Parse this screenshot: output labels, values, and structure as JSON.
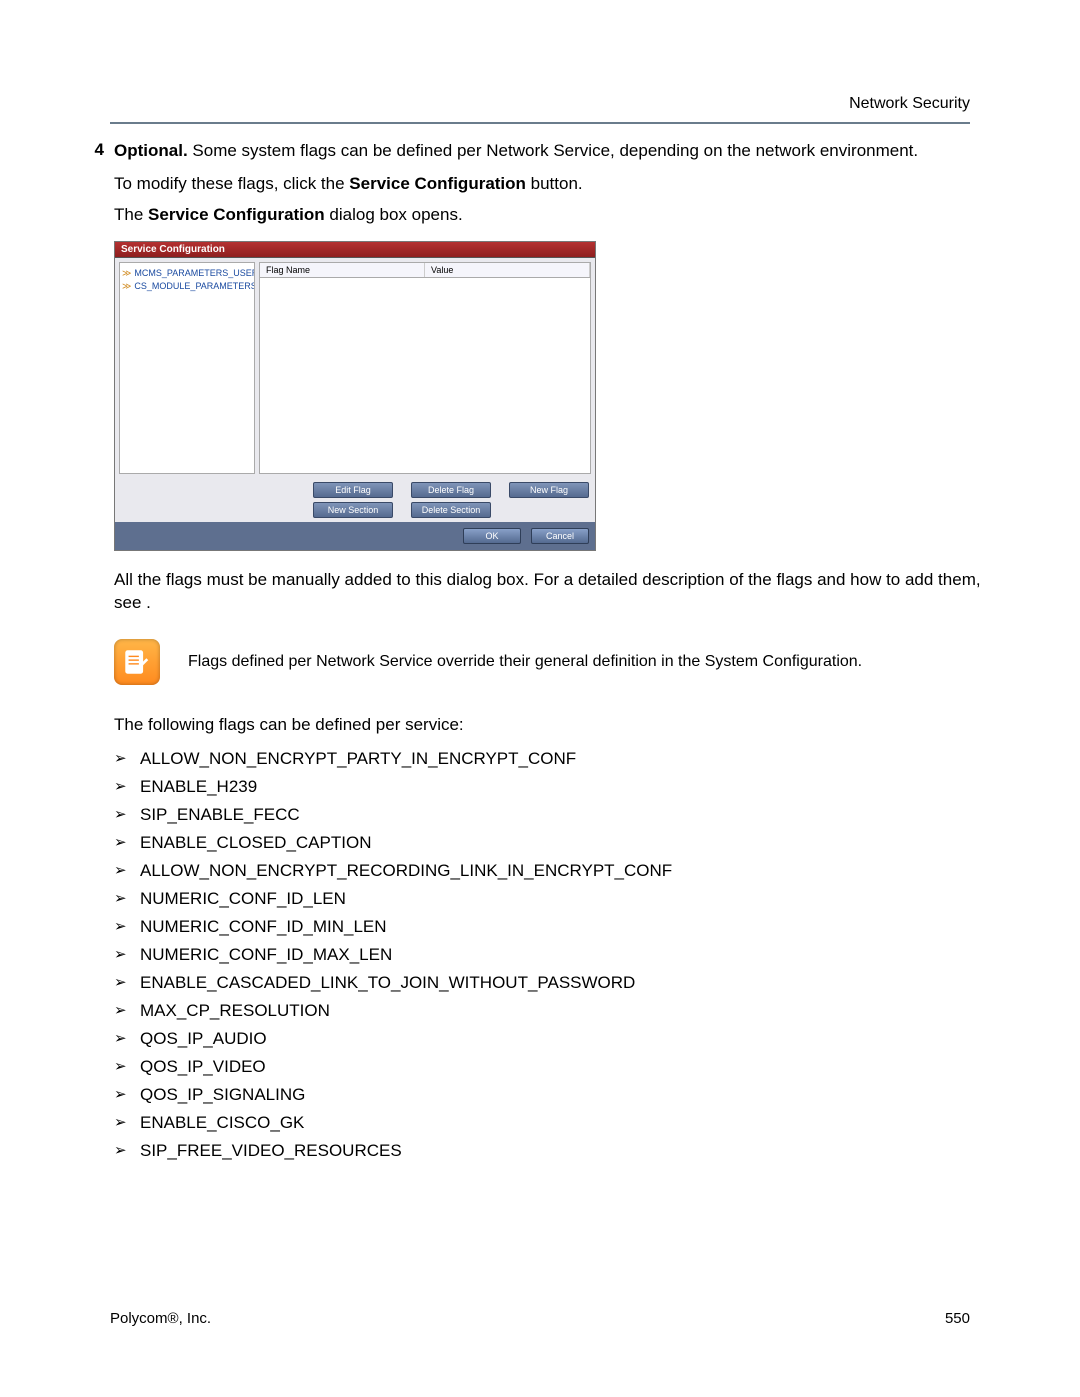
{
  "header": {
    "title": "Network Security"
  },
  "step": {
    "num": "4",
    "lead_bold": "Optional.",
    "lead_rest": " Some system flags can be defined per Network Service, depending on the network environment.",
    "modify_pre": "To modify these flags, click the ",
    "modify_bold": "Service Configuration",
    "modify_post": " button.",
    "open_pre": "The ",
    "open_bold": "Service Configuration",
    "open_post": " dialog box opens."
  },
  "dialog": {
    "title": "Service Configuration",
    "tree": [
      "MCMS_PARAMETERS_USER",
      "CS_MODULE_PARAMETERS"
    ],
    "columns": {
      "c1": "Flag Name",
      "c2": "Value"
    },
    "buttons": {
      "edit_flag": "Edit Flag",
      "delete_flag": "Delete Flag",
      "new_flag": "New Flag",
      "new_section": "New Section",
      "delete_section": "Delete Section",
      "ok": "OK",
      "cancel": "Cancel"
    }
  },
  "after_dialog": "All the flags must be manually added to this dialog box. For a detailed description of the flags and how to add them, see .",
  "note": "Flags defined per Network Service override their general definition in the System Configuration.",
  "flags_intro": "The following flags can be defined per service:",
  "flags": [
    "ALLOW_NON_ENCRYPT_PARTY_IN_ENCRYPT_CONF",
    "ENABLE_H239",
    "SIP_ENABLE_FECC",
    "ENABLE_CLOSED_CAPTION",
    "ALLOW_NON_ENCRYPT_RECORDING_LINK_IN_ENCRYPT_CONF",
    "NUMERIC_CONF_ID_LEN",
    "NUMERIC_CONF_ID_MIN_LEN",
    "NUMERIC_CONF_ID_MAX_LEN",
    "ENABLE_CASCADED_LINK_TO_JOIN_WITHOUT_PASSWORD",
    "MAX_CP_RESOLUTION",
    "QOS_IP_AUDIO",
    "QOS_IP_VIDEO",
    "QOS_IP_SIGNALING",
    "ENABLE_CISCO_GK",
    "SIP_FREE_VIDEO_RESOURCES"
  ],
  "footer": {
    "left": "Polycom®, Inc.",
    "right": "550"
  }
}
